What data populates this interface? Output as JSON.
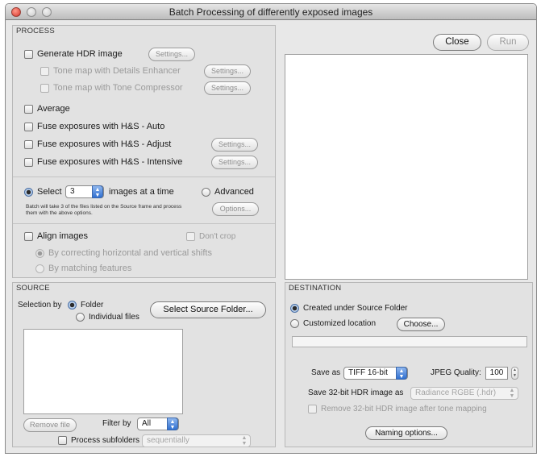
{
  "window": {
    "title": "Batch Processing of differently exposed images"
  },
  "process": {
    "section_label": "PROCESS",
    "generate_hdr": {
      "label": "Generate HDR image",
      "settings_label": "Settings..."
    },
    "tone_details": {
      "label": "Tone map with Details Enhancer",
      "settings_label": "Settings..."
    },
    "tone_compressor": {
      "label": "Tone map with Tone Compressor",
      "settings_label": "Settings..."
    },
    "average": {
      "label": "Average"
    },
    "fuse_auto": {
      "label": "Fuse exposures with H&S - Auto"
    },
    "fuse_adjust": {
      "label": "Fuse exposures with H&S - Adjust",
      "settings_label": "Settings..."
    },
    "fuse_intensive": {
      "label": "Fuse exposures with H&S - Intensive",
      "settings_label": "Settings..."
    },
    "select": {
      "label": "Select",
      "count": "3",
      "suffix": "images at a time",
      "help": "Batch will take 3 of the files listed on the Source frame and process them with the above options."
    },
    "advanced": {
      "label": "Advanced",
      "options_label": "Options..."
    },
    "align": {
      "label": "Align images",
      "dont_crop": "Don't crop",
      "by_shifts": "By correcting horizontal and vertical shifts",
      "by_features": "By matching features"
    }
  },
  "toolbar": {
    "close_label": "Close",
    "run_label": "Run"
  },
  "source": {
    "section_label": "SOURCE",
    "selection_by": "Selection by",
    "folder": "Folder",
    "individual_files": "Individual files",
    "select_folder_button": "Select Source Folder...",
    "remove_file": "Remove file",
    "filter_by": "Filter by",
    "filter_value": "All",
    "process_subfolders": "Process subfolders",
    "subfolder_mode": "sequentially"
  },
  "destination": {
    "section_label": "DESTINATION",
    "created_under": "Created under Source Folder",
    "customized": "Customized location",
    "choose_button": "Choose...",
    "save_as_label": "Save as",
    "save_as_value": "TIFF 16-bit",
    "jpeg_quality_label": "JPEG Quality:",
    "jpeg_quality_value": "100",
    "save32_label": "Save 32-bit HDR image as",
    "save32_value": "Radiance RGBE (.hdr)",
    "remove32_label": "Remove 32-bit HDR image after tone mapping",
    "naming_button": "Naming options..."
  },
  "colors": {
    "window_bg": "#e8e8e8",
    "accent": "#2f6fd1",
    "close_light": "#d8342a"
  },
  "icons": [
    "close-light-icon",
    "minimize-light-icon",
    "zoom-light-icon",
    "popup-arrows-icon",
    "stepper-icon"
  ]
}
